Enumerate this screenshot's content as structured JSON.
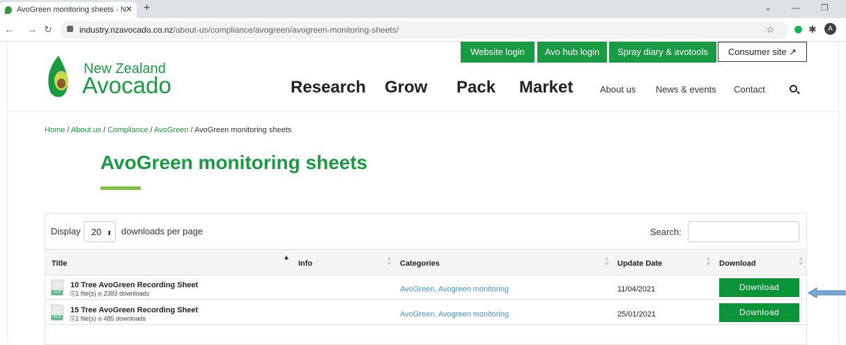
{
  "browser": {
    "tab_title": "AvoGreen monitoring sheets - N",
    "tab_close": "✕",
    "new_tab": "+",
    "url_host": "industry.nzavocado.co.nz",
    "url_path": "/about-us/compliance/avogreen/avogreen-monitoring-sheets/",
    "profile_initial": "A"
  },
  "header": {
    "top_links": [
      "Website login",
      "Avo hub login",
      "Spray diary & avotools"
    ],
    "consumer_site": "Consumer site",
    "logo_line1": "New Zealand",
    "logo_line2": "Avocado",
    "main_nav": [
      "Research",
      "Grow",
      "Pack",
      "Market"
    ],
    "sub_nav": [
      "About us",
      "News & events",
      "Contact"
    ]
  },
  "breadcrumb": {
    "items": [
      "Home",
      "About us",
      "Compliance",
      "AvoGreen"
    ],
    "separator": " / ",
    "current": "AvoGreen monitoring sheets"
  },
  "page": {
    "title": "AvoGreen monitoring sheets"
  },
  "table": {
    "display_label": "Display",
    "per_page_value": "20",
    "per_page_suffix": "downloads per page",
    "search_label": "Search:",
    "columns": [
      "Title",
      "Info",
      "Categories",
      "Update Date",
      "Download"
    ],
    "rows": [
      {
        "title": "10 Tree AvoGreen Recording Sheet",
        "meta": "1 file(s) ⓘ 2383 downloads",
        "files": "1 file(s)",
        "downloads": "2383 downloads",
        "categories": "AvoGreen, Avogreen monitoring",
        "date": "11/04/2021",
        "button": "Download"
      },
      {
        "title": "15 Tree AvoGreen Recording Sheet",
        "files": "1 file(s)",
        "downloads": "485 downloads",
        "categories": "AvoGreen, Avogreen monitoring",
        "date": "25/01/2021",
        "button": "Download"
      }
    ],
    "file_type": "XLS"
  },
  "colors": {
    "brand_green": "#1a9a42",
    "button_green": "#0c9438",
    "accent_lime": "#7cc242",
    "link_blue": "#4a90d9",
    "annotation_arrow": "#4a7fc1"
  }
}
